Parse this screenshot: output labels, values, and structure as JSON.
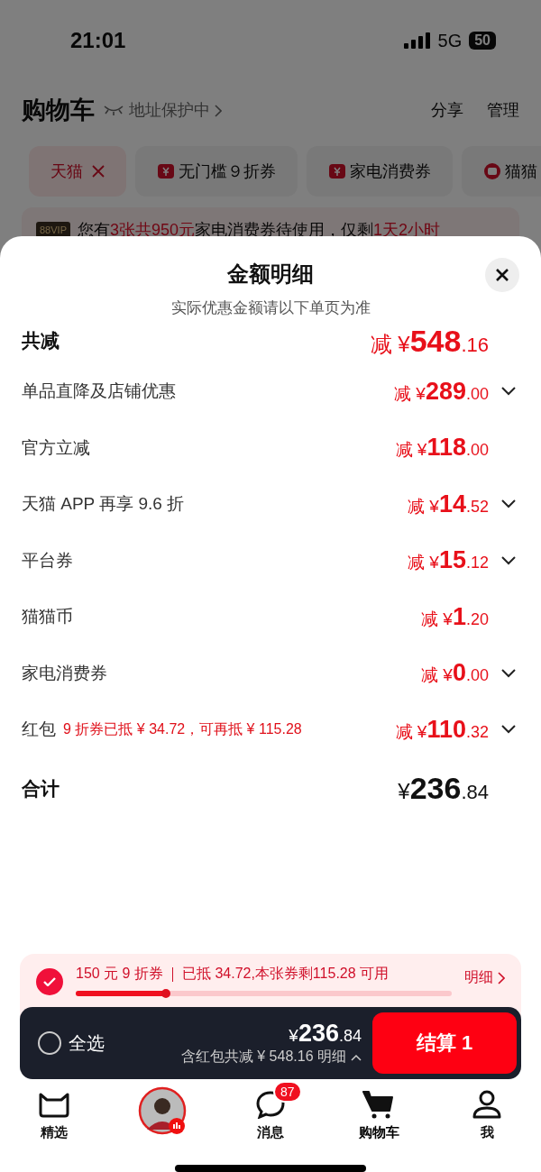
{
  "status_bar": {
    "time": "21:01",
    "network": "5G",
    "battery": "50"
  },
  "header": {
    "title": "购物车",
    "address_note": "地址保护中",
    "actions": [
      "分享",
      "管理"
    ]
  },
  "filter_chips": [
    {
      "label": "天猫",
      "kind": "removable",
      "selected": true
    },
    {
      "label": "无门槛９折券",
      "kind": "coupon",
      "selected": false
    },
    {
      "label": "家电消费券",
      "kind": "coupon",
      "selected": false
    },
    {
      "label": "猫猫",
      "kind": "coin",
      "selected": false
    }
  ],
  "banner": {
    "badge": "88VIP",
    "text": "您有**3张共950元**家电消费券待使用，仅剩**1天2小时**"
  },
  "sheet": {
    "title": "金额明细",
    "subtitle": "实际优惠金额请以下单页为准",
    "total_discount": {
      "label": "共减",
      "prefix": "减 ¥",
      "main": "548",
      "cents": ".16"
    },
    "rows": [
      {
        "label": "单品直降及店铺优惠",
        "prefix": "减 ¥",
        "main": "289",
        "cents": ".00",
        "expandable": true
      },
      {
        "label": "官方立减",
        "prefix": "减 ¥",
        "main": "118",
        "cents": ".00",
        "expandable": false
      },
      {
        "label": "天猫 APP 再享 9.6 折",
        "prefix": "减 ¥",
        "main": "14",
        "cents": ".52",
        "expandable": true
      },
      {
        "label": "平台券",
        "prefix": "减 ¥",
        "main": "15",
        "cents": ".12",
        "expandable": true
      },
      {
        "label": "猫猫币",
        "prefix": "减 ¥",
        "main": "1",
        "cents": ".20",
        "expandable": false
      },
      {
        "label": "家电消费券",
        "prefix": "减 ¥",
        "main": "0",
        "cents": ".00",
        "expandable": true
      },
      {
        "label": "红包",
        "note": "9 折券已抵 ¥ 34.72，可再抵 ¥ 115.28",
        "prefix": "减 ¥",
        "main": "110",
        "cents": ".32",
        "expandable": true
      }
    ],
    "sum": {
      "label": "合计",
      "prefix": "¥",
      "main": "236",
      "cents": ".84"
    }
  },
  "coupon_bar": {
    "checked": true,
    "name": "150 元 9 折券",
    "detail": "已抵 34.72,本张券剩115.28 可用",
    "link": "明细",
    "level": 0.24
  },
  "checkout_bar": {
    "select_all": {
      "label": "全选",
      "checked": false
    },
    "prefix": "¥",
    "main": "236",
    "cents": ".84",
    "note": "含红包共减 ¥ 548.16  明细",
    "button": "结算 1"
  },
  "tab_bar": [
    {
      "label": "精选",
      "kind": "home",
      "selected": false
    },
    {
      "kind": "avatar",
      "selected": false
    },
    {
      "label": "消息",
      "kind": "message",
      "badge": "87",
      "selected": false
    },
    {
      "label": "购物车",
      "kind": "cart",
      "selected": true
    },
    {
      "label": "我",
      "kind": "me",
      "selected": false
    }
  ]
}
